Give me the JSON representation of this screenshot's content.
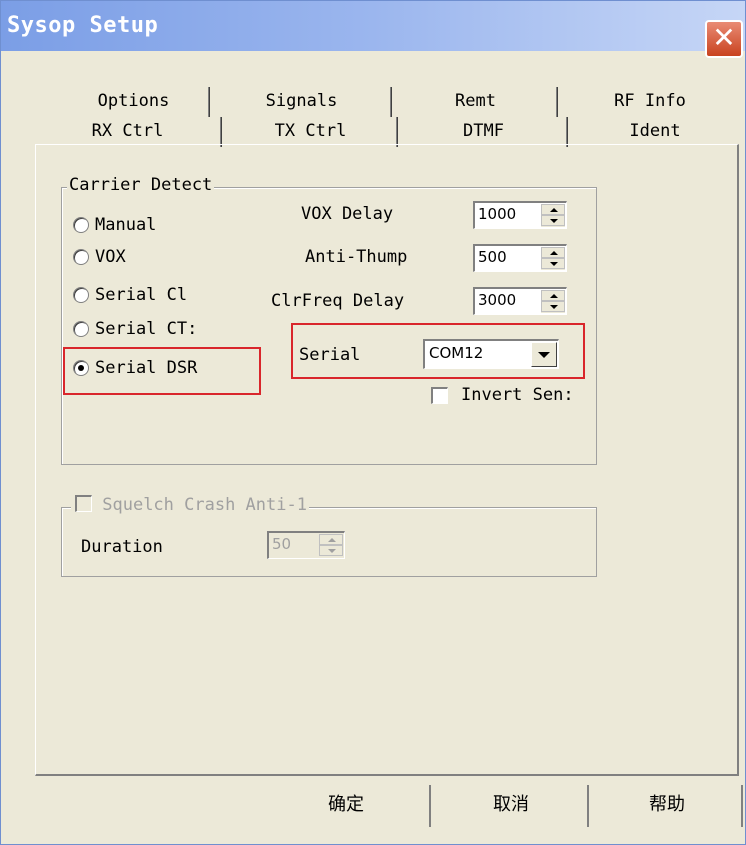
{
  "window": {
    "title": "Sysop Setup",
    "close_glyph": "✕"
  },
  "tabs": {
    "row1": [
      {
        "label": "Options"
      },
      {
        "label": "Signals"
      },
      {
        "label": "Remt"
      },
      {
        "label": "RF Info"
      }
    ],
    "row2": [
      {
        "label": "RX Ctrl",
        "active": true
      },
      {
        "label": "TX Ctrl"
      },
      {
        "label": "DTMF"
      },
      {
        "label": "Ident"
      }
    ]
  },
  "carrier_detect": {
    "legend": "Carrier Detect",
    "options": [
      {
        "label": "Manual",
        "checked": false
      },
      {
        "label": "VOX",
        "checked": false
      },
      {
        "label": "Serial Cl",
        "checked": false
      },
      {
        "label": "Serial CT:",
        "checked": false
      },
      {
        "label": "Serial DSR",
        "checked": true
      }
    ],
    "vox_delay": {
      "label": "VOX Delay",
      "value": "1000"
    },
    "anti_thump": {
      "label": "Anti-Thump",
      "value": "500"
    },
    "clrfreq_delay": {
      "label": "ClrFreq Delay",
      "value": "3000"
    },
    "serial": {
      "label": "Serial",
      "value": "COM12"
    },
    "invert": {
      "label": "Invert Sen:",
      "checked": false
    }
  },
  "squelch": {
    "legend": "Squelch Crash Anti-1",
    "enabled": false,
    "duration": {
      "label": "Duration",
      "value": "50"
    }
  },
  "buttons": {
    "ok": "确定",
    "cancel": "取消",
    "help": "帮助"
  },
  "colors": {
    "highlight": "#d9262b",
    "dialog_bg": "#ece9d8",
    "title_gradient_start": "#7b9ee6"
  }
}
